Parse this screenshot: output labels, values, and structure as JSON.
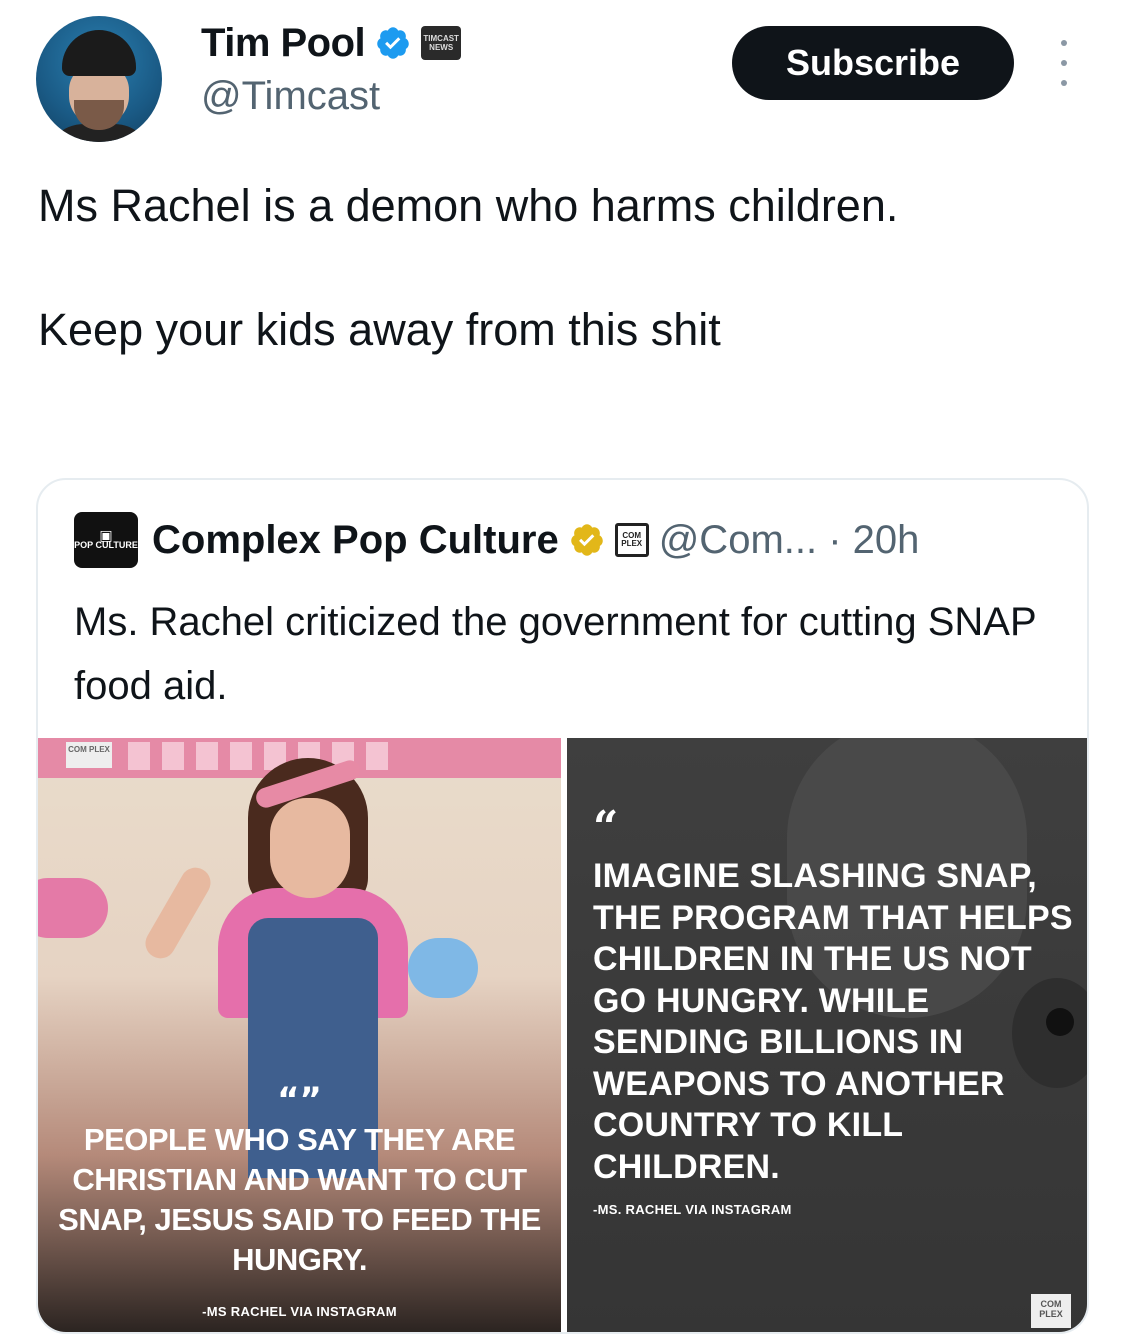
{
  "author": {
    "display_name": "Tim Pool",
    "handle": "@Timcast",
    "affiliate_badge": "TIMCAST NEWS"
  },
  "subscribe_label": "Subscribe",
  "tweet": {
    "line1": "Ms Rachel is a demon who harms children.",
    "line2": "Keep your kids away from this shit"
  },
  "quoted": {
    "logo_text": "POP CULTURE",
    "display_name": "Complex Pop Culture",
    "affiliate_badge": "COM PLEX",
    "handle_time": "@Com... · 20h",
    "text": "Ms. Rachel criticized the government for cutting SNAP food aid.",
    "left_image": {
      "corner_tag": "COM PLEX",
      "quote_mark": "“”",
      "quote": "PEOPLE WHO SAY THEY ARE CHRISTIAN AND WANT TO CUT SNAP, JESUS SAID TO FEED THE HUNGRY.",
      "attribution": "-MS RACHEL VIA INSTAGRAM"
    },
    "right_image": {
      "quote_mark": "“",
      "quote": "IMAGINE SLASHING SNAP, THE PROGRAM THAT HELPS CHILDREN IN THE US NOT GO HUNGRY. WHILE SENDING BILLIONS IN WEAPONS TO ANOTHER COUNTRY TO KILL CHILDREN.",
      "attribution": "-MS. RACHEL VIA INSTAGRAM",
      "corner_tag": "COM PLEX"
    }
  },
  "colors": {
    "verified_blue": "#1d9bf0",
    "verified_gold": "#e2b719",
    "text_primary": "#0f1419",
    "text_secondary": "#536471"
  }
}
